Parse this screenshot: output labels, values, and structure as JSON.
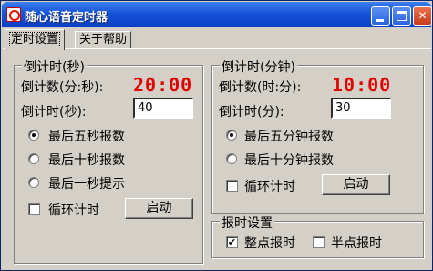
{
  "window": {
    "title": "随心语音定时器",
    "icons": {
      "app": "clock-icon",
      "minimize": "minimize-icon",
      "maximize": "maximize-icon",
      "close": "close-icon"
    },
    "close_glyph": "✕"
  },
  "tabs": [
    {
      "label": "定时设置",
      "active": true
    },
    {
      "label": "关于帮助",
      "active": false
    }
  ],
  "seconds_group": {
    "legend": "倒计时(秒)",
    "count_label": "倒计数(分:秒):",
    "count_value": "20:00",
    "input_label": "倒计时(秒):",
    "input_value": "40",
    "radios": [
      {
        "label": "最后五秒报数",
        "checked": true
      },
      {
        "label": "最后十秒报数",
        "checked": false
      },
      {
        "label": "最后一秒提示",
        "checked": false
      }
    ],
    "loop_label": "循环计时",
    "loop_checked": false,
    "start_label": "启动"
  },
  "minutes_group": {
    "legend": "倒计时(分钟)",
    "count_label": "倒计数(时:分):",
    "count_value": "10:00",
    "input_label": "倒计时(分):",
    "input_value": "30",
    "radios": [
      {
        "label": "最后五分钟报数",
        "checked": true
      },
      {
        "label": "最后十分钟报数",
        "checked": false
      }
    ],
    "loop_label": "循环计时",
    "loop_checked": false,
    "start_label": "启动"
  },
  "chime_group": {
    "legend": "报时设置",
    "hourly_label": "整点报时",
    "hourly_checked": true,
    "half_hour_label": "半点报时",
    "half_hour_checked": false,
    "check_glyph": "✔"
  },
  "colors": {
    "countdown_text": "#e00000",
    "titlebar": "#0a3fc4",
    "window_bg": "#d4d0c8"
  }
}
